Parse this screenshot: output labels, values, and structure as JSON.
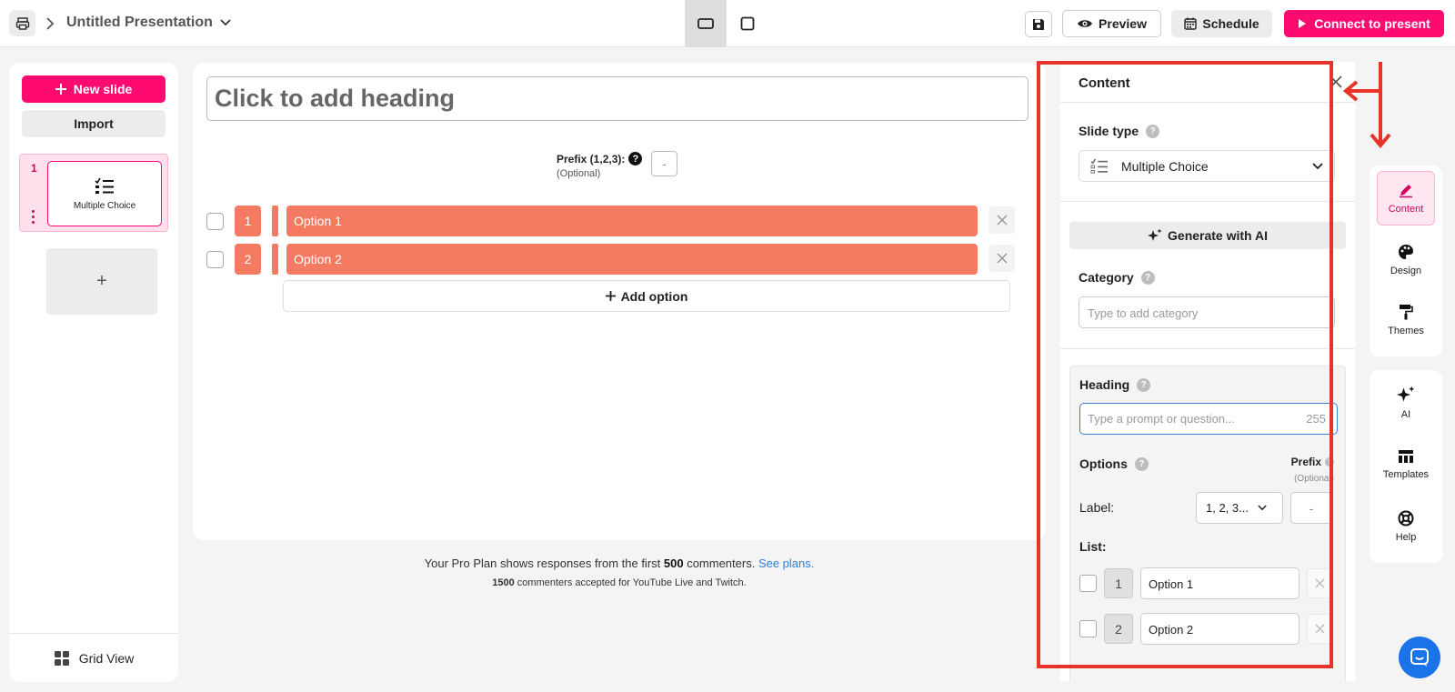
{
  "topbar": {
    "title": "Untitled Presentation",
    "preview_label": "Preview",
    "schedule_label": "Schedule",
    "connect_label": "Connect to present"
  },
  "sidebar": {
    "new_slide_label": "New slide",
    "import_label": "Import",
    "slides": [
      {
        "number": "1",
        "label": "Multiple Choice"
      }
    ],
    "add_tile_label": "+",
    "grid_view_label": "Grid View"
  },
  "canvas": {
    "heading_placeholder": "Click to add heading",
    "prefix_label": "Prefix (1,2,3):",
    "prefix_optional": "(Optional)",
    "prefix_value": "-",
    "options": [
      {
        "number": "1",
        "text": "Option 1"
      },
      {
        "number": "2",
        "text": "Option 2"
      }
    ],
    "add_option_label": "Add option"
  },
  "footer": {
    "line1_pre": "Your Pro Plan shows responses from the first ",
    "line1_count": "500",
    "line1_post": " commenters. ",
    "see_plans": "See plans.",
    "line2_count": "1500",
    "line2_post": " commenters accepted for YouTube Live and Twitch."
  },
  "content_panel": {
    "title": "Content",
    "slide_type_label": "Slide type",
    "slide_type_value": "Multiple Choice",
    "generate_ai_label": "Generate with AI",
    "category_label": "Category",
    "category_placeholder": "Type to add category",
    "heading_label": "Heading",
    "heading_placeholder": "Type a prompt or question...",
    "heading_count": "255",
    "options_label": "Options",
    "prefix_label": "Prefix",
    "prefix_optional": "(Optional)",
    "label_label": "Label:",
    "label_value": "1, 2, 3...",
    "prefix_value": "-",
    "list_label": "List:",
    "list": [
      {
        "number": "1",
        "text": "Option 1"
      },
      {
        "number": "2",
        "text": "Option 2"
      }
    ]
  },
  "rail": {
    "content": "Content",
    "design": "Design",
    "themes": "Themes",
    "ai": "AI",
    "templates": "Templates",
    "help": "Help"
  },
  "colors": {
    "brand_pink": "#ff0a71",
    "option_coral": "#f47b62",
    "highlight_red": "#e8332a",
    "link_blue": "#2f80d9"
  }
}
